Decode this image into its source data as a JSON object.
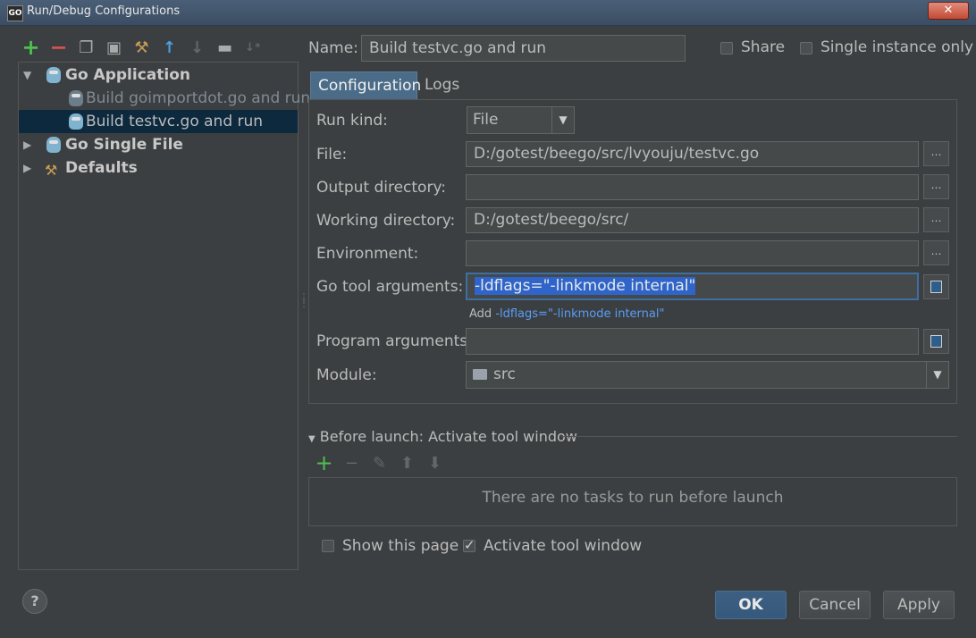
{
  "window": {
    "title": "Run/Debug Configurations",
    "app_icon_text": "GO",
    "close_glyph": "✕"
  },
  "tree": {
    "go_application": "Go Application",
    "build_goimportdot": "Build goimportdot.go and run",
    "build_testvc": "Build testvc.go and run",
    "go_single_file": "Go Single File",
    "defaults": "Defaults"
  },
  "header": {
    "name_label": "Name:",
    "name_value": "Build testvc.go and run",
    "share_label": "Share",
    "single_instance_label": "Single instance only"
  },
  "tabs": {
    "configuration": "Configuration",
    "logs": "Logs"
  },
  "form": {
    "run_kind_label": "Run kind:",
    "run_kind_value": "File",
    "file_label": "File:",
    "file_value": "D:/gotest/beego/src/lvyouju/testvc.go",
    "output_dir_label": "Output directory:",
    "output_dir_value": "",
    "working_dir_label": "Working directory:",
    "working_dir_value": "D:/gotest/beego/src/",
    "environment_label": "Environment:",
    "environment_value": "",
    "go_tool_args_label": "Go tool arguments:",
    "go_tool_args_value": "-ldflags=\"-linkmode internal\"",
    "hint_prefix": "Add",
    "hint_flag": "-ldflags=\"-linkmode internal\"",
    "program_args_label": "Program arguments:",
    "program_args_value": "",
    "module_label": "Module:",
    "module_value": "src",
    "browse_glyph": "…"
  },
  "before_launch": {
    "title": "Before launch: Activate tool window",
    "empty_text": "There are no tasks to run before launch",
    "show_page_label": "Show this page",
    "activate_tool_window_label": "Activate tool window"
  },
  "buttons": {
    "ok": "OK",
    "cancel": "Cancel",
    "apply": "Apply",
    "help": "?"
  }
}
